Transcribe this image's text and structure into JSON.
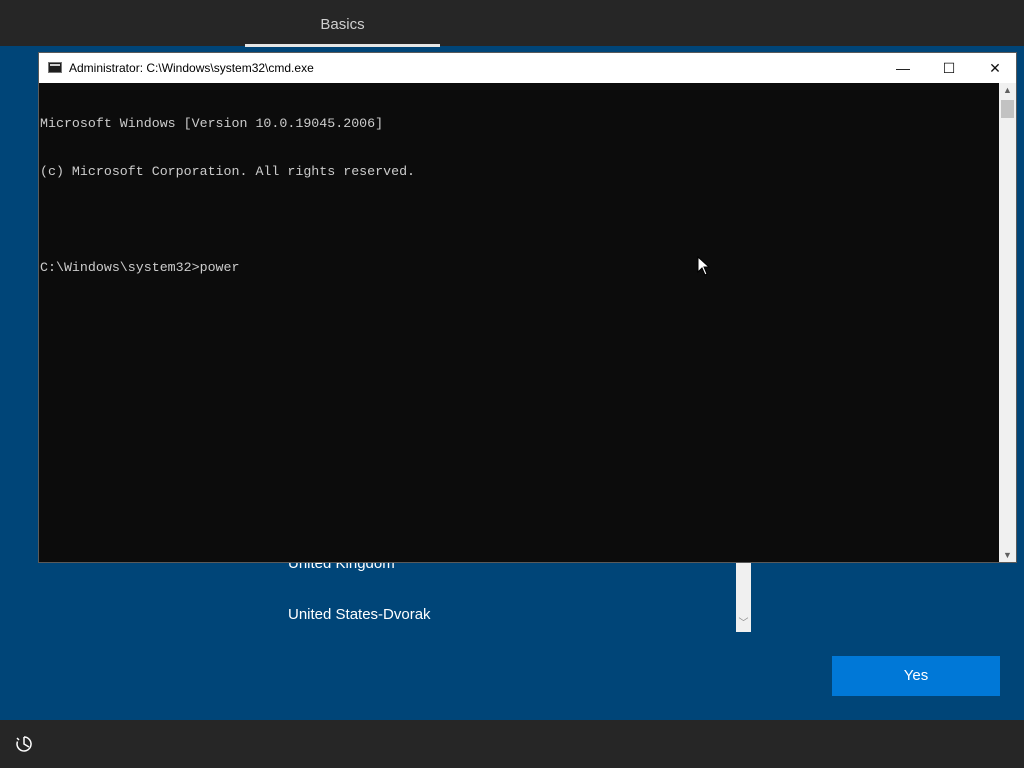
{
  "header": {
    "tab_label": "Basics"
  },
  "oobe": {
    "keyboard_items": [
      "United Kingdom",
      "United States-Dvorak"
    ],
    "yes_label": "Yes"
  },
  "cmd": {
    "title": "Administrator: C:\\Windows\\system32\\cmd.exe",
    "lines": [
      "Microsoft Windows [Version 10.0.19045.2006]",
      "(c) Microsoft Corporation. All rights reserved.",
      "",
      "C:\\Windows\\system32>power"
    ],
    "min_glyph": "—",
    "max_glyph": "☐",
    "close_glyph": "✕"
  },
  "icons": {
    "accessibility": "ease-of-access-icon",
    "cmd": "cmd-icon"
  },
  "colors": {
    "background": "#004578",
    "accent_button": "#0078d7",
    "bar": "#262626",
    "console_bg": "#0c0c0c",
    "console_text": "#cccccc"
  }
}
